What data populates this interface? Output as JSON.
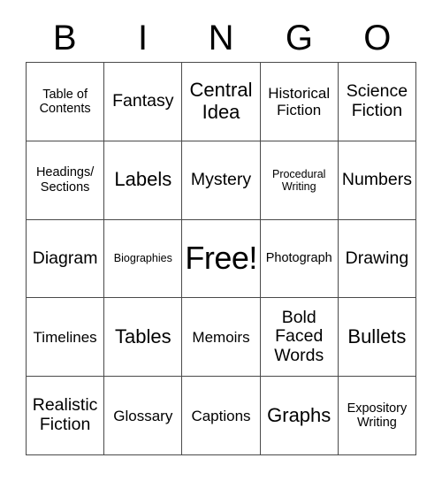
{
  "header": {
    "letters": [
      "B",
      "I",
      "N",
      "G",
      "O"
    ]
  },
  "grid": {
    "rows": [
      [
        {
          "label": "Table of Contents",
          "size": "sm"
        },
        {
          "label": "Fantasy",
          "size": "lg"
        },
        {
          "label": "Central Idea",
          "size": "xl"
        },
        {
          "label": "Historical Fiction",
          "size": "md"
        },
        {
          "label": "Science Fiction",
          "size": "lg"
        }
      ],
      [
        {
          "label": "Headings/ Sections",
          "size": "sm"
        },
        {
          "label": "Labels",
          "size": "xl"
        },
        {
          "label": "Mystery",
          "size": "lg"
        },
        {
          "label": "Procedural Writing",
          "size": "xs"
        },
        {
          "label": "Numbers",
          "size": "lg"
        }
      ],
      [
        {
          "label": "Diagram",
          "size": "lg"
        },
        {
          "label": "Biographies",
          "size": "xs"
        },
        {
          "label": "Free!",
          "size": "free"
        },
        {
          "label": "Photograph",
          "size": "sm"
        },
        {
          "label": "Drawing",
          "size": "lg"
        }
      ],
      [
        {
          "label": "Timelines",
          "size": "md"
        },
        {
          "label": "Tables",
          "size": "xl"
        },
        {
          "label": "Memoirs",
          "size": "md"
        },
        {
          "label": "Bold Faced Words",
          "size": "lg"
        },
        {
          "label": "Bullets",
          "size": "xl"
        }
      ],
      [
        {
          "label": "Realistic Fiction",
          "size": "lg"
        },
        {
          "label": "Glossary",
          "size": "md"
        },
        {
          "label": "Captions",
          "size": "md"
        },
        {
          "label": "Graphs",
          "size": "xl"
        },
        {
          "label": "Expository Writing",
          "size": "sm"
        }
      ]
    ]
  },
  "colors": {
    "border": "#4a4a4a",
    "text": "#000000",
    "background": "#ffffff"
  }
}
